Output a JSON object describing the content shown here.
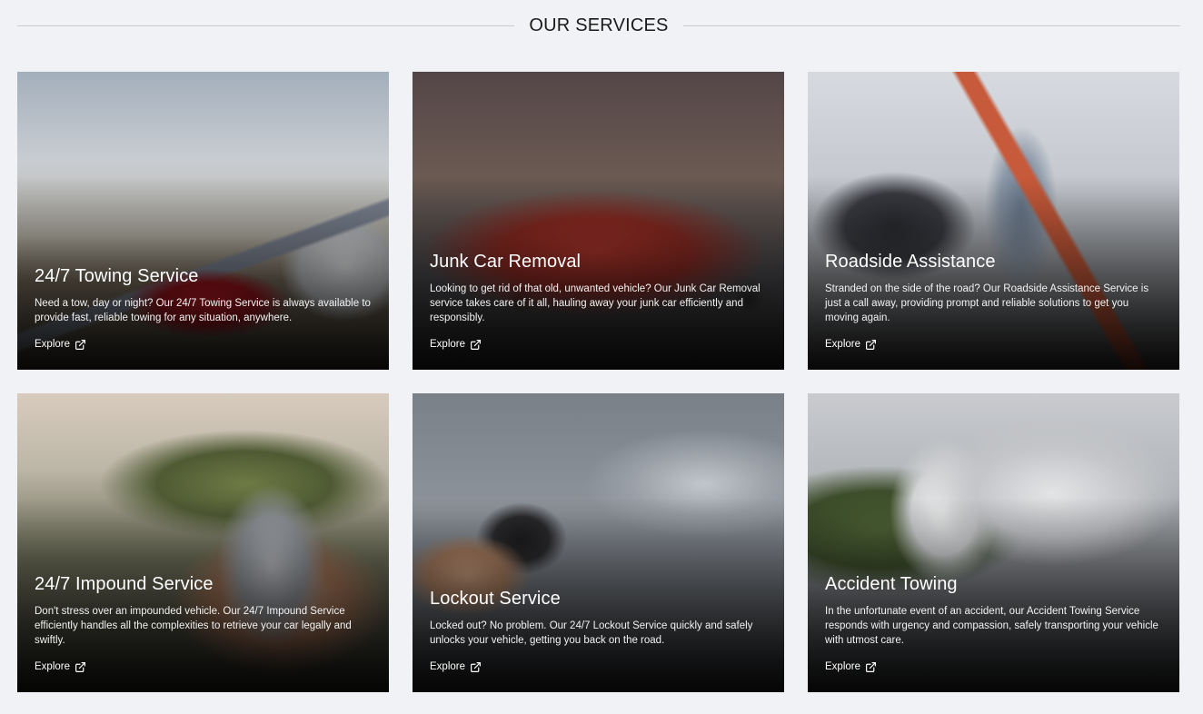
{
  "section": {
    "title": "OUR SERVICES"
  },
  "services": [
    {
      "title": "24/7 Towing Service",
      "description": "Need a tow, day or night? Our 24/7 Towing Service is always available to provide fast, reliable towing for any situation, anywhere.",
      "link_label": "Explore",
      "icon": "external-link-icon"
    },
    {
      "title": "Junk Car Removal",
      "description": "Looking to get rid of that old, unwanted vehicle? Our Junk Car Removal service takes care of it all, hauling away your junk car efficiently and responsibly.",
      "link_label": "Explore",
      "icon": "external-link-icon"
    },
    {
      "title": "Roadside Assistance",
      "description": "Stranded on the side of the road? Our Roadside Assistance Service is just a call away, providing prompt and reliable solutions to get you moving again.",
      "link_label": "Explore",
      "icon": "external-link-icon"
    },
    {
      "title": "24/7 Impound Service",
      "description": "Don't stress over an impounded vehicle. Our 24/7 Impound Service efficiently handles all the complexities to retrieve your car legally and swiftly.",
      "link_label": "Explore",
      "icon": "external-link-icon"
    },
    {
      "title": "Lockout Service",
      "description": "Locked out? No problem. Our 24/7 Lockout Service quickly and safely unlocks your vehicle, getting you back on the road.",
      "link_label": "Explore",
      "icon": "external-link-icon"
    },
    {
      "title": "Accident Towing",
      "description": "In the unfortunate event of an accident, our Accident Towing Service responds with urgency and compassion, safely transporting your vehicle with utmost care.",
      "link_label": "Explore",
      "icon": "external-link-icon"
    }
  ],
  "colors": {
    "page_background": "#f0f2f5",
    "title_text": "#1a1a1a",
    "card_text": "#ffffff"
  }
}
